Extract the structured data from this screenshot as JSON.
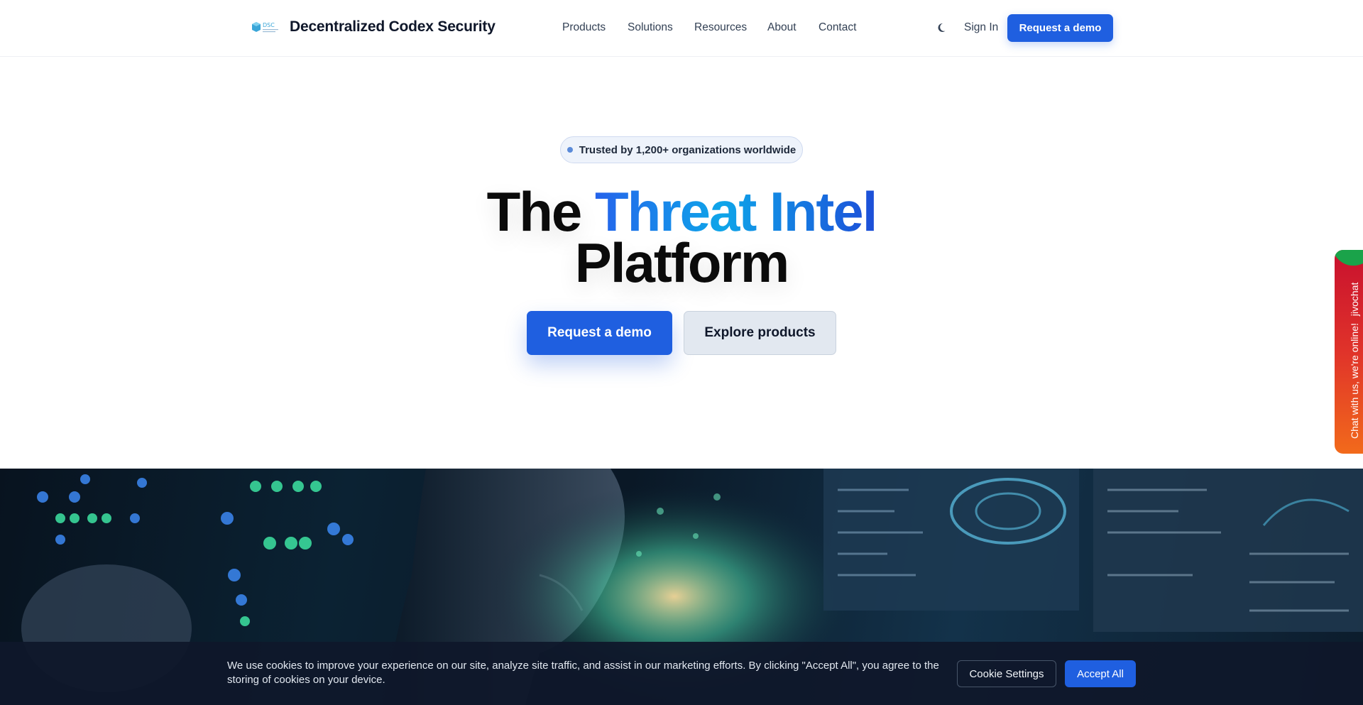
{
  "header": {
    "logo_text": "DSC",
    "brand": "Decentralized Codex Security",
    "nav": [
      "Products",
      "Solutions",
      "Resources",
      "About",
      "Contact"
    ],
    "theme_icon": "moon-icon",
    "sign_in": "Sign In",
    "cta": "Request a demo"
  },
  "hero": {
    "badge": "Trusted by 1,200+ organizations worldwide",
    "title_prefix": "The ",
    "title_highlight": "Threat Intel",
    "title_line2": "Platform",
    "primary_cta": "Request a demo",
    "secondary_cta": "Explore products"
  },
  "chat_widget": {
    "label": "Chat with us, we're online!",
    "brand": "jivochat"
  },
  "cookie_banner": {
    "text": "We use cookies to improve your experience on our site, analyze site traffic, and assist in our marketing efforts. By clicking \"Accept All\", you agree to the storing of cookies on your device.",
    "settings_label": "Cookie Settings",
    "accept_label": "Accept All"
  },
  "colors": {
    "primary": "#1f5fe0",
    "gradient_start": "#2563eb",
    "gradient_mid": "#0ea5e9",
    "banner_bg": "#0f172a",
    "chat_red": "#c8102e",
    "chat_orange": "#f26a1b"
  }
}
